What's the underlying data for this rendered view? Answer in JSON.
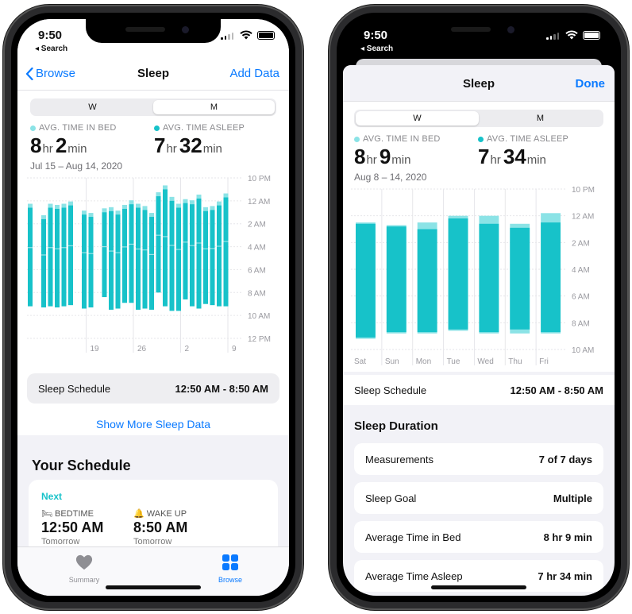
{
  "colors": {
    "accent": "#17c2c9",
    "accent_light": "#8be3e6",
    "link": "#0a7aff"
  },
  "left": {
    "status": {
      "time": "9:50",
      "back_app": "◂ Search"
    },
    "nav": {
      "back_label": "Browse",
      "title": "Sleep",
      "action_label": "Add Data"
    },
    "segment": {
      "options": [
        "W",
        "M"
      ],
      "selected": "M"
    },
    "stats": {
      "in_bed": {
        "label": "AVG. TIME IN BED",
        "hours": "8",
        "hr_unit": "hr",
        "minutes": "2",
        "min_unit": "min"
      },
      "asleep": {
        "label": "AVG. TIME ASLEEP",
        "hours": "7",
        "hr_unit": "hr",
        "minutes": "32",
        "min_unit": "min"
      },
      "date_range": "Jul 15 – Aug 14, 2020"
    },
    "schedule_row": {
      "label": "Sleep Schedule",
      "value": "12:50 AM - 8:50 AM"
    },
    "more_link": "Show More Sleep Data",
    "your_schedule": {
      "heading": "Your Schedule",
      "next_label": "Next",
      "bedtime": {
        "icon": "bed-icon",
        "label": "BEDTIME",
        "time": "12:50 AM",
        "day": "Tomorrow"
      },
      "wakeup": {
        "icon": "alarm-icon",
        "label": "WAKE UP",
        "time": "8:50 AM",
        "day": "Tomorrow"
      }
    },
    "tabs": [
      {
        "icon": "heart-icon",
        "label": "Summary",
        "active": false
      },
      {
        "icon": "grid-icon",
        "label": "Browse",
        "active": true
      }
    ]
  },
  "right": {
    "status": {
      "time": "9:50",
      "back_app": "◂ Search"
    },
    "sheet": {
      "title": "Sleep",
      "done_label": "Done"
    },
    "segment": {
      "options": [
        "W",
        "M"
      ],
      "selected": "W"
    },
    "stats": {
      "in_bed": {
        "label": "AVG. TIME IN BED",
        "hours": "8",
        "hr_unit": "hr",
        "minutes": "9",
        "min_unit": "min"
      },
      "asleep": {
        "label": "AVG. TIME ASLEEP",
        "hours": "7",
        "hr_unit": "hr",
        "minutes": "34",
        "min_unit": "min"
      },
      "date_range": "Aug 8 – 14, 2020"
    },
    "schedule_row": {
      "label": "Sleep Schedule",
      "value": "12:50 AM - 8:50 AM"
    },
    "duration": {
      "heading": "Sleep Duration",
      "rows": [
        {
          "label": "Measurements",
          "value": "7 of 7 days"
        },
        {
          "label": "Sleep Goal",
          "value": "Multiple"
        },
        {
          "label": "Average Time in Bed",
          "value": "8 hr 9 min"
        },
        {
          "label": "Average Time Asleep",
          "value": "7 hr 34 min"
        }
      ]
    }
  },
  "chart_data": [
    {
      "type": "bar",
      "title": "",
      "xlabel": "",
      "ylabel": "",
      "y_axis_labels": [
        "10 PM",
        "12 AM",
        "2 AM",
        "4 AM",
        "6 AM",
        "8 AM",
        "10 AM",
        "12 PM"
      ],
      "ylim_hours_after_10pm": [
        0,
        14
      ],
      "x_tick_labels": [
        "19",
        "26",
        "2",
        "9"
      ],
      "grid": true,
      "series": [
        {
          "name": "",
          "ranges": [
            [
              2.6,
              11.2
            ],
            [
              3.6,
              11.3
            ],
            [
              2.6,
              11.2
            ],
            [
              2.7,
              11.3
            ],
            [
              2.6,
              11.2
            ],
            [
              2.4,
              11.1
            ],
            [
              3.2,
              11.4
            ],
            [
              3.4,
              11.3
            ],
            [
              3.0,
              10.4
            ],
            [
              2.9,
              11.5
            ],
            [
              3.2,
              11.4
            ],
            [
              2.7,
              10.9
            ],
            [
              2.3,
              10.9
            ],
            [
              2.6,
              11.5
            ],
            [
              2.8,
              11.4
            ],
            [
              3.4,
              11.5
            ],
            [
              1.6,
              10.0
            ],
            [
              1.0,
              11.2
            ],
            [
              2.0,
              11.6
            ],
            [
              2.6,
              11.6
            ],
            [
              2.2,
              10.6
            ],
            [
              2.3,
              11.2
            ],
            [
              1.8,
              11.4
            ],
            [
              2.9,
              11.0
            ],
            [
              2.8,
              11.1
            ],
            [
              2.4,
              11.2
            ],
            [
              1.7,
              11.2
            ]
          ]
        }
      ],
      "days": 32,
      "day_offsets": [
        0,
        2,
        3,
        4,
        5,
        6,
        8,
        9,
        11,
        12,
        13,
        14,
        15,
        16,
        17,
        18,
        19,
        20,
        21,
        22,
        23,
        24,
        25,
        26,
        27,
        28,
        29
      ]
    },
    {
      "type": "bar",
      "title": "",
      "xlabel": "",
      "ylabel": "",
      "y_axis_labels": [
        "10 PM",
        "12 AM",
        "2 AM",
        "4 AM",
        "6 AM",
        "8 AM",
        "10 AM"
      ],
      "ylim_hours_after_10pm": [
        0,
        12
      ],
      "categories": [
        "Sat",
        "Sun",
        "Mon",
        "Tue",
        "Wed",
        "Thu",
        "Fri"
      ],
      "in_bed_ranges": [
        [
          2.5,
          11.2
        ],
        [
          2.7,
          10.8
        ],
        [
          2.5,
          10.8
        ],
        [
          2.0,
          10.6
        ],
        [
          2.0,
          10.8
        ],
        [
          2.6,
          10.8
        ],
        [
          1.8,
          10.8
        ]
      ],
      "asleep_ranges": [
        [
          2.6,
          11.1
        ],
        [
          2.8,
          10.7
        ],
        [
          3.0,
          10.7
        ],
        [
          2.2,
          10.5
        ],
        [
          2.6,
          10.7
        ],
        [
          2.9,
          10.5
        ],
        [
          2.5,
          10.7
        ]
      ]
    }
  ]
}
